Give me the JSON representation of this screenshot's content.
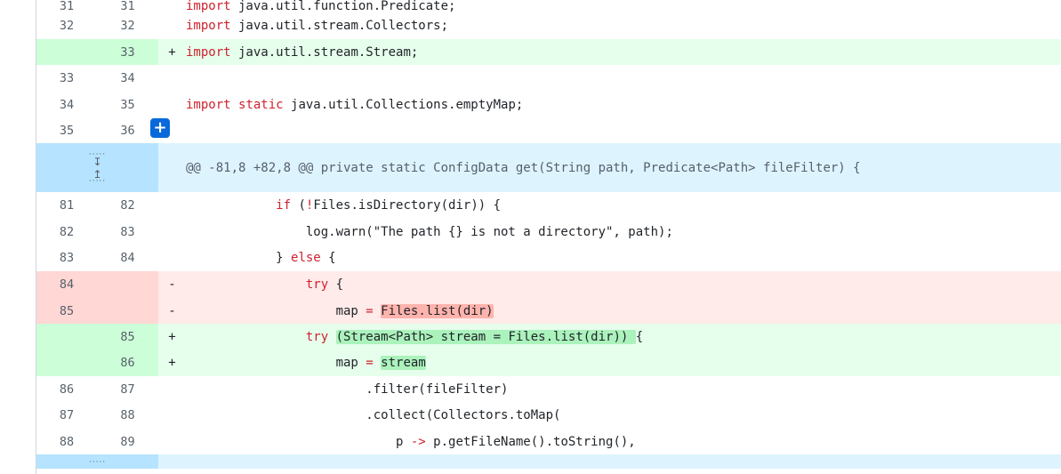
{
  "lines": [
    {
      "type": "ctx",
      "old": "31",
      "new": "31",
      "marker": "",
      "segments": [
        {
          "t": "import",
          "c": "kw"
        },
        {
          "t": " java.util.function.Predicate;"
        }
      ]
    },
    {
      "type": "ctx",
      "old": "32",
      "new": "32",
      "marker": "",
      "segments": [
        {
          "t": "import",
          "c": "kw"
        },
        {
          "t": " java.util.stream.Collectors;"
        }
      ]
    },
    {
      "type": "add",
      "old": "",
      "new": "33",
      "marker": "+",
      "segments": [
        {
          "t": "import",
          "c": "kw"
        },
        {
          "t": " java.util.stream.Stream;"
        }
      ]
    },
    {
      "type": "ctx",
      "old": "33",
      "new": "34",
      "marker": "",
      "segments": []
    },
    {
      "type": "ctx",
      "old": "34",
      "new": "35",
      "marker": "",
      "segments": [
        {
          "t": "import",
          "c": "kw"
        },
        {
          "t": " "
        },
        {
          "t": "static",
          "c": "kw"
        },
        {
          "t": " java.util.Collections.emptyMap;"
        }
      ]
    },
    {
      "type": "ctx",
      "old": "35",
      "new": "36",
      "marker": "",
      "segments": [],
      "plus": true
    },
    {
      "type": "hunk",
      "text": "@@ -81,8 +82,8 @@ private static ConfigData get(String path, Predicate<Path> fileFilter) {"
    },
    {
      "type": "ctx",
      "old": "81",
      "new": "82",
      "marker": "",
      "segments": [
        {
          "t": "            "
        },
        {
          "t": "if",
          "c": "kw"
        },
        {
          "t": " ("
        },
        {
          "t": "!",
          "c": "kw"
        },
        {
          "t": "Files.isDirectory(dir)) {"
        }
      ]
    },
    {
      "type": "ctx",
      "old": "82",
      "new": "83",
      "marker": "",
      "segments": [
        {
          "t": "                log.warn(\"The path {} is not a directory\", path);"
        }
      ]
    },
    {
      "type": "ctx",
      "old": "83",
      "new": "84",
      "marker": "",
      "segments": [
        {
          "t": "            } "
        },
        {
          "t": "else",
          "c": "kw"
        },
        {
          "t": " {"
        }
      ]
    },
    {
      "type": "del",
      "old": "84",
      "new": "",
      "marker": "-",
      "segments": [
        {
          "t": "                "
        },
        {
          "t": "try",
          "c": "kw"
        },
        {
          "t": " {"
        }
      ]
    },
    {
      "type": "del",
      "old": "85",
      "new": "",
      "marker": "-",
      "segments": [
        {
          "t": "                    map "
        },
        {
          "t": "=",
          "c": "kw"
        },
        {
          "t": " "
        },
        {
          "t": "Files.list(dir)",
          "c": "hl-del"
        }
      ]
    },
    {
      "type": "add",
      "old": "",
      "new": "85",
      "marker": "+",
      "segments": [
        {
          "t": "                "
        },
        {
          "t": "try",
          "c": "kw"
        },
        {
          "t": " "
        },
        {
          "t": "(Stream<Path> stream = Files.list(dir)) ",
          "c": "hl-add"
        },
        {
          "t": "{"
        }
      ]
    },
    {
      "type": "add",
      "old": "",
      "new": "86",
      "marker": "+",
      "segments": [
        {
          "t": "                    map "
        },
        {
          "t": "=",
          "c": "kw"
        },
        {
          "t": " "
        },
        {
          "t": "stream",
          "c": "hl-add"
        }
      ]
    },
    {
      "type": "ctx",
      "old": "86",
      "new": "87",
      "marker": "",
      "segments": [
        {
          "t": "                        .filter(fileFilter)"
        }
      ]
    },
    {
      "type": "ctx",
      "old": "87",
      "new": "88",
      "marker": "",
      "segments": [
        {
          "t": "                        .collect(Collectors.toMap("
        }
      ]
    },
    {
      "type": "ctx",
      "old": "88",
      "new": "89",
      "marker": "",
      "segments": [
        {
          "t": "                            p "
        },
        {
          "t": "->",
          "c": "kw"
        },
        {
          "t": " p.getFileName().toString(),"
        }
      ]
    },
    {
      "type": "expander"
    }
  ],
  "add_comment_label": "+",
  "expand_down_icon": "expand-down-icon",
  "expand_up_icon": "expand-up-icon"
}
